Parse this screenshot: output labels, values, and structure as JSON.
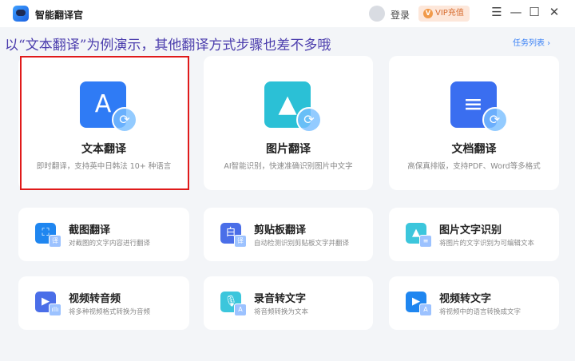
{
  "app": {
    "title": "智能翻译官",
    "login": "登录",
    "vip": "VIP充值",
    "vip_icon": "V"
  },
  "window": {
    "menu": "☰",
    "minimize": "—",
    "maximize": "☐",
    "close": "✕"
  },
  "annotation": "以“文本翻译”为例演示，其他翻译方式步骤也差不多哦",
  "tasks_link": "任务列表 ›",
  "main_cards": [
    {
      "title": "文本翻译",
      "desc": "即时翻译，支持英中日韩法 10+ 种语言",
      "glyph": "A",
      "color": "#2f7bf5"
    },
    {
      "title": "图片翻译",
      "desc": "AI智能识别，快速准确识别图片中文字",
      "glyph": "▲",
      "color": "#2bc0d6"
    },
    {
      "title": "文档翻译",
      "desc": "高保真排版，支持PDF、Word等多格式",
      "glyph": "≡",
      "color": "#3a6ef0"
    }
  ],
  "tools": [
    {
      "title": "截图翻译",
      "desc": "对截图的文字内容进行翻译",
      "glyph": "⛶",
      "badge": "译",
      "color": "#1f86f0"
    },
    {
      "title": "剪贴板翻译",
      "desc": "自动检测识别剪贴板文字并翻译",
      "glyph": "白",
      "badge": "译",
      "color": "#4a6ee8"
    },
    {
      "title": "图片文字识别",
      "desc": "将图片的文字识别为可编辑文本",
      "glyph": "▲",
      "badge": "≡",
      "color": "#3cc6dc"
    },
    {
      "title": "视频转音频",
      "desc": "将多种视频格式转换为音频",
      "glyph": "▶",
      "badge": "ıllı",
      "color": "#4a6ee8"
    },
    {
      "title": "录音转文字",
      "desc": "将音频转换为文本",
      "glyph": "🎙",
      "badge": "A",
      "color": "#3cc6dc"
    },
    {
      "title": "视频转文字",
      "desc": "将视频中的语言转换成文字",
      "glyph": "▶",
      "badge": "A",
      "color": "#1f86f0"
    }
  ]
}
